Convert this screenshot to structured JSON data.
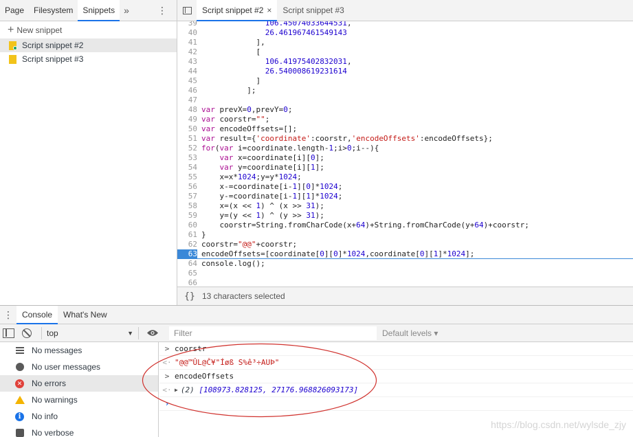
{
  "navigator": {
    "tabs": [
      "Page",
      "Filesystem",
      "Snippets"
    ],
    "more": "»",
    "menu": "⋮",
    "new_snippet": "New snippet",
    "files": [
      "Script snippet #2",
      "Script snippet #3"
    ]
  },
  "editor": {
    "tabs": [
      {
        "label": "Script snippet #2",
        "close": "×"
      },
      {
        "label": "Script snippet #3"
      }
    ],
    "lines": [
      {
        "n": "39",
        "text": "              106.45074033644531,"
      },
      {
        "n": "40",
        "text": "              26.461967461549143"
      },
      {
        "n": "41",
        "text": "            ],"
      },
      {
        "n": "42",
        "text": "            ["
      },
      {
        "n": "43",
        "text": "              106.41975402832031,"
      },
      {
        "n": "44",
        "text": "              26.540008619231614"
      },
      {
        "n": "45",
        "text": "            ]"
      },
      {
        "n": "46",
        "text": "          ];"
      },
      {
        "n": "47",
        "text": ""
      },
      {
        "n": "48",
        "text": "var prevX=0,prevY=0;"
      },
      {
        "n": "49",
        "text": "var coorstr=\"\";"
      },
      {
        "n": "50",
        "text": "var encodeOffsets=[];"
      },
      {
        "n": "51",
        "text": "var result={'coordinate':coorstr,'encodeOffsets':encodeOffsets};"
      },
      {
        "n": "52",
        "text": "for(var i=coordinate.length-1;i>0;i--){"
      },
      {
        "n": "53",
        "text": "    var x=coordinate[i][0];"
      },
      {
        "n": "54",
        "text": "    var y=coordinate[i][1];"
      },
      {
        "n": "55",
        "text": "    x=x*1024;y=y*1024;"
      },
      {
        "n": "56",
        "text": "    x-=coordinate[i-1][0]*1024;"
      },
      {
        "n": "57",
        "text": "    y-=coordinate[i-1][1]*1024;"
      },
      {
        "n": "58",
        "text": "    x=(x << 1) ^ (x >> 31);"
      },
      {
        "n": "59",
        "text": "    y=(y << 1) ^ (y >> 31);"
      },
      {
        "n": "60",
        "text": "    coorstr=String.fromCharCode(x+64)+String.fromCharCode(y+64)+coorstr;"
      },
      {
        "n": "61",
        "text": "}"
      },
      {
        "n": "62",
        "text": "coorstr=\"@@\"+coorstr;"
      },
      {
        "n": "63",
        "text": "encodeOffsets=[coordinate[0][0]*1024,coordinate[0][1]*1024];",
        "current": true
      },
      {
        "n": "64",
        "text": "console.log();"
      },
      {
        "n": "65",
        "text": ""
      },
      {
        "n": "66",
        "text": ""
      }
    ],
    "status": {
      "format": "{}",
      "selection": "13 characters selected"
    }
  },
  "drawer": {
    "menu": "⋮",
    "tabs": [
      "Console",
      "What's New"
    ],
    "toolbar": {
      "context": "top",
      "filter_placeholder": "Filter",
      "levels": "Default levels ▾"
    },
    "sidebar": [
      {
        "label": "No messages",
        "icon": "list-icon"
      },
      {
        "label": "No user messages",
        "icon": "user-icon"
      },
      {
        "label": "No errors",
        "icon": "error-icon",
        "selected": true
      },
      {
        "label": "No warnings",
        "icon": "warning-icon"
      },
      {
        "label": "No info",
        "icon": "info-icon"
      },
      {
        "label": "No verbose",
        "icon": "verbose-icon"
      }
    ],
    "log": {
      "cmd1": "coorstr",
      "result1": "\"@@™ÛL@Č¥\"Íøß S%ê³÷AUÞ\"",
      "cmd2": "encodeOffsets",
      "result2_count": "(2)",
      "result2_values": "[108973.828125, 27176.968826093173]"
    }
  },
  "watermark": "https://blog.csdn.net/wylsde_zjy",
  "colors": {
    "accent": "#1a73e8",
    "annotation": "#d0312d",
    "current_line": "#3a88d8"
  }
}
